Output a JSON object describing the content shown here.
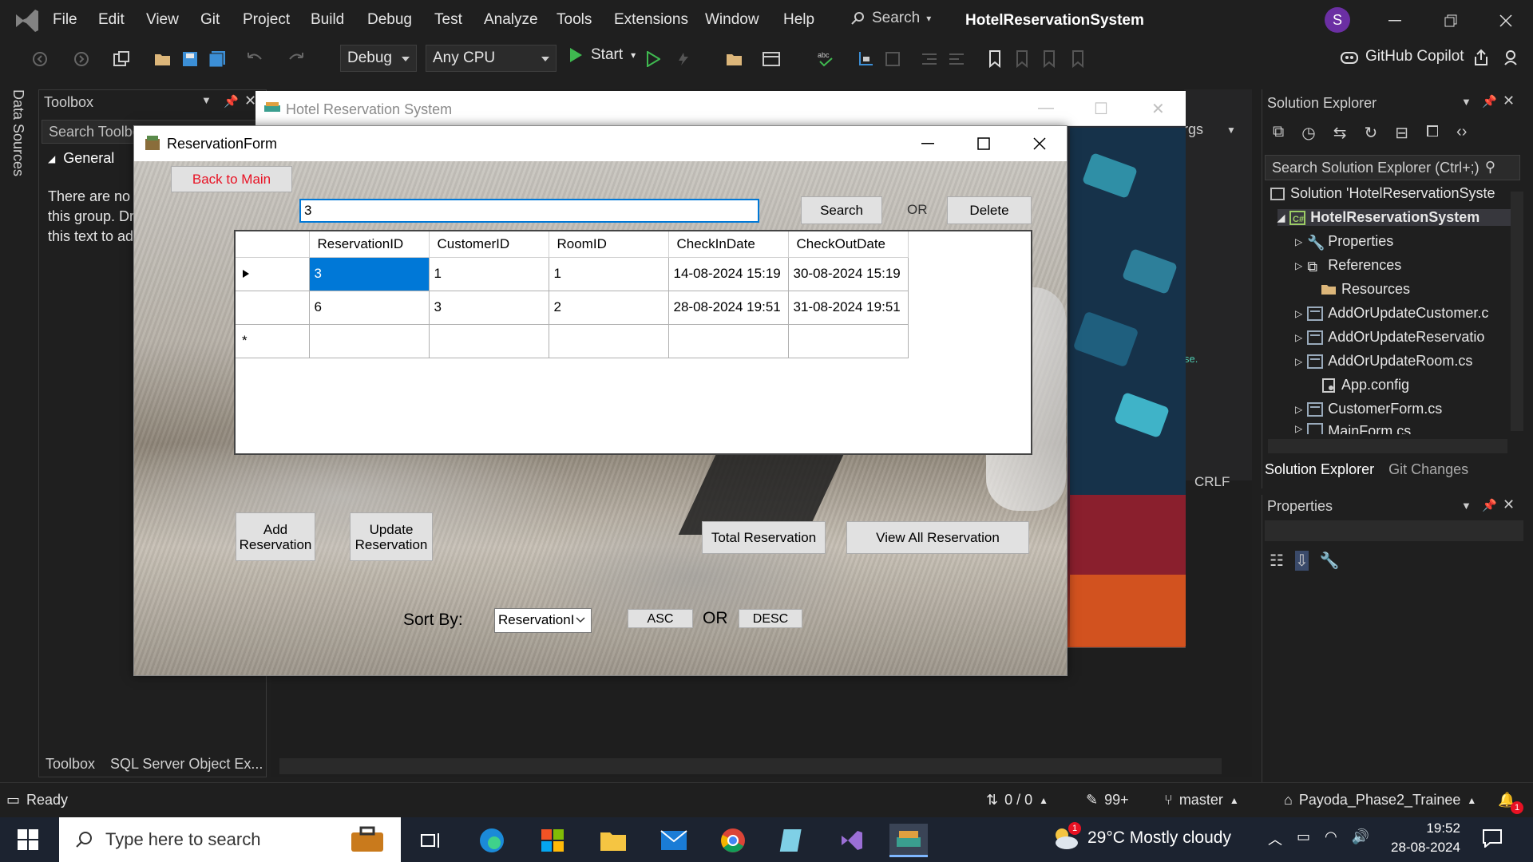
{
  "menu": [
    "File",
    "Edit",
    "View",
    "Git",
    "Project",
    "Build",
    "Debug",
    "Test",
    "Analyze",
    "Tools",
    "Extensions",
    "Window",
    "Help"
  ],
  "search_label": "Search",
  "app_title": "HotelReservationSystem",
  "avatar_letter": "S",
  "toolbar": {
    "config": "Debug",
    "platform": "Any CPU",
    "start": "Start",
    "copilot": "GitHub Copilot"
  },
  "side": {
    "data_sources": "Data Sources"
  },
  "toolbox": {
    "title": "Toolbox",
    "search_placeholder": "Search Toolbox",
    "group": "General",
    "empty_lines": [
      "There are no usable controls in",
      "this group. Drag an item onto",
      "this text to add it to the toolbox."
    ],
    "tabs": [
      "Toolbox",
      "SQL Server Object Ex..."
    ]
  },
  "editor": {
    "args_fragment": "rgs",
    "crlf": "CRLF",
    "code_fragment": "se."
  },
  "solution_explorer": {
    "title": "Solution Explorer",
    "search_placeholder": "Search Solution Explorer (Ctrl+;)",
    "items": [
      {
        "label": "Solution 'HotelReservationSyste",
        "icon": "solution-icon"
      },
      {
        "label": "HotelReservationSystem",
        "icon": "csharp-project-icon"
      },
      {
        "label": "Properties",
        "icon": "wrench-icon"
      },
      {
        "label": "References",
        "icon": "references-icon"
      },
      {
        "label": "Resources",
        "icon": "folder-icon"
      },
      {
        "label": "AddOrUpdateCustomer.c",
        "icon": "form-icon"
      },
      {
        "label": "AddOrUpdateReservatio",
        "icon": "form-icon"
      },
      {
        "label": "AddOrUpdateRoom.cs",
        "icon": "form-icon"
      },
      {
        "label": "App.config",
        "icon": "config-icon"
      },
      {
        "label": "CustomerForm.cs",
        "icon": "form-icon"
      },
      {
        "label": "MainForm.cs",
        "icon": "form-icon"
      }
    ],
    "tabs": [
      "Solution Explorer",
      "Git Changes"
    ]
  },
  "properties": {
    "title": "Properties"
  },
  "status": {
    "ready": "Ready",
    "lines": "0 / 0",
    "edits": "99+",
    "branch": "master",
    "repo": "Payoda_Phase2_Trainee",
    "notifications": "1"
  },
  "hrs_window": {
    "title": "Hotel Reservation System"
  },
  "form": {
    "title": "ReservationForm",
    "back": "Back to Main",
    "search_value": "3",
    "search": "Search",
    "or": "OR",
    "delete": "Delete",
    "columns": [
      "ReservationID",
      "CustomerID",
      "RoomID",
      "CheckInDate",
      "CheckOutDate"
    ],
    "rows": [
      [
        "3",
        "1",
        "1",
        "14-08-2024 15:19",
        "30-08-2024 15:19"
      ],
      [
        "6",
        "3",
        "2",
        "28-08-2024 19:51",
        "31-08-2024 19:51"
      ]
    ],
    "new_row_marker": "*",
    "add": "Add Reservation",
    "update": "Update Reservation",
    "total": "Total Reservation",
    "view_all": "View All Reservation",
    "sort_by": "Sort By:",
    "sort_value": "ReservationI",
    "asc": "ASC",
    "or2": "OR",
    "desc": "DESC"
  },
  "taskbar": {
    "search_placeholder": "Type here to search",
    "weather": "29°C  Mostly cloudy",
    "weather_badge": "1",
    "time": "19:52",
    "date": "28-08-2024"
  },
  "colors": {
    "accent": "#0078d7",
    "vs_purple": "#6b2fa3",
    "back_red": "#e81123"
  }
}
